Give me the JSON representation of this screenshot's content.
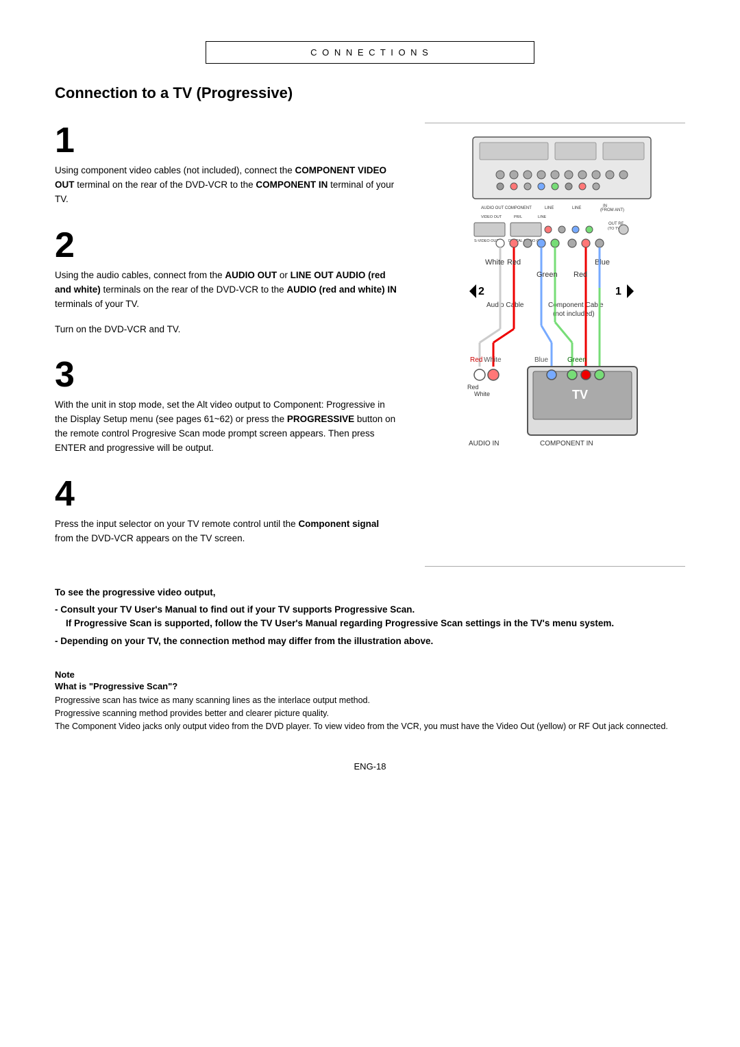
{
  "header": {
    "section_label": "C O N N E C T I O N S"
  },
  "page_title": "Connection to a TV (Progressive)",
  "steps": [
    {
      "number": "1",
      "text": "Using component video cables (not included), connect the ",
      "bold1": "COMPONENT VIDEO OUT",
      "text2": " terminal on the rear of the DVD-VCR to the ",
      "bold2": "COMPONENT IN",
      "text3": " terminal of your TV."
    },
    {
      "number": "2",
      "text": "Using the audio cables, connect from the ",
      "bold1": "AUDIO OUT",
      "text2": " or ",
      "bold2": "LINE OUT AUDIO (red and white)",
      "text3": " terminals on the rear of the DVD-VCR to the ",
      "bold3": "AUDIO (red and white) IN",
      "text4": " terminals of your TV.",
      "extra": "Turn on the DVD-VCR and TV."
    },
    {
      "number": "3",
      "text": "With the unit in stop mode, set the Alt video output to Component: Progressive in the Display Setup menu (see pages 61~62) or press the ",
      "bold1": "PROGRESSIVE",
      "text2": " button on the remote control Progresive Scan mode prompt screen appears. Then press ENTER and progressive will be output."
    },
    {
      "number": "4",
      "text": "Press the input selector on your TV remote control until the ",
      "bold1": "Component signal",
      "text2": " from the DVD-VCR appears on the TV screen."
    }
  ],
  "progressive_section": {
    "heading": "To see the progressive video output,",
    "bullets": [
      "Consult your TV User's Manual to find out if your TV supports Progressive Scan. If Progressive Scan is supported, follow the TV User's Manual regarding Progressive Scan settings in the TV's menu system.",
      "Depending on your TV, the connection method may differ from the illustration above."
    ]
  },
  "note_section": {
    "title": "Note",
    "subtitle": "What is \"Progressive Scan\"?",
    "lines": [
      "Progressive scan has twice as many scanning lines as the interlace output method.",
      "Progressive scanning method provides better and clearer picture quality.",
      "The Component Video jacks only output video from the DVD player. To view video from the VCR, you must have the Video Out (yellow) or RF Out jack connected."
    ]
  },
  "page_number": "ENG-18",
  "diagram": {
    "cable_labels": {
      "white": "White",
      "red": "Red",
      "blue": "Blue",
      "green": "Green",
      "audio_cable": "Audio Cable",
      "component_cable": "Component Cable",
      "not_included": "(not included)",
      "audio_in": "AUDIO IN",
      "component_in": "COMPONENT IN",
      "tv": "TV",
      "step2_arrow": "2",
      "step1_arrow": "1"
    }
  }
}
